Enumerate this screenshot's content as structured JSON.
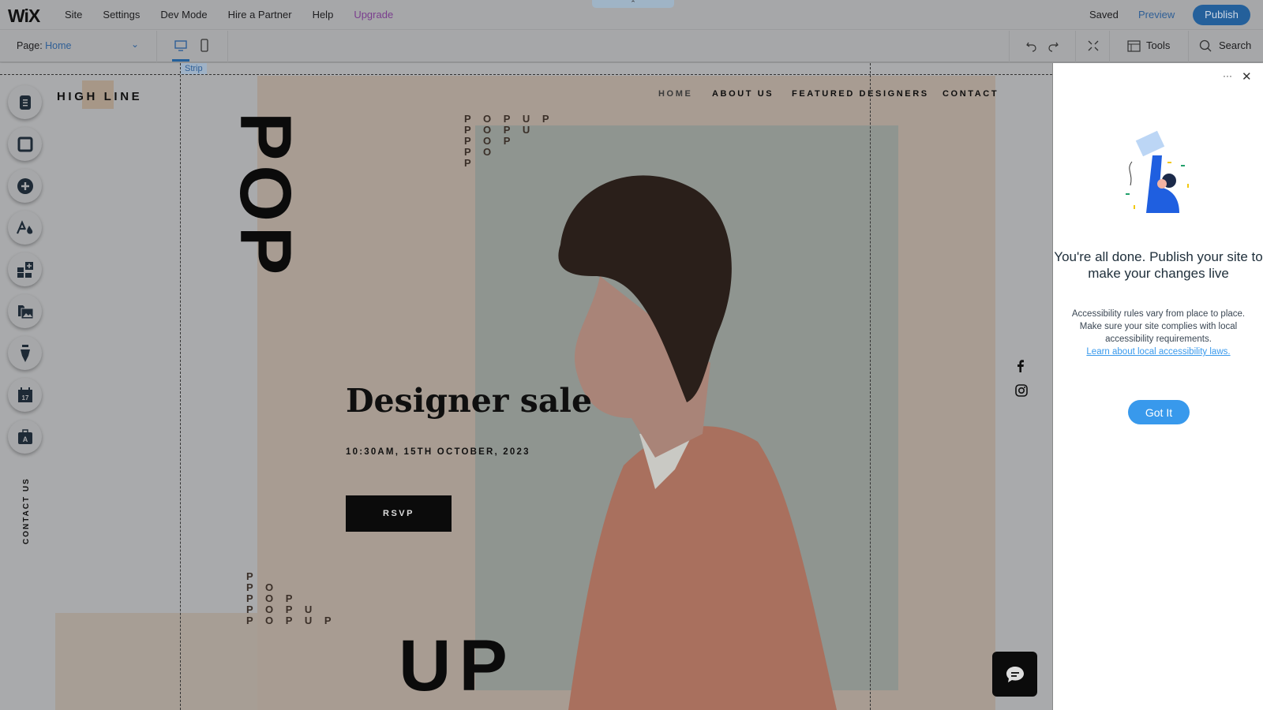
{
  "topbar": {
    "logo": "WiX",
    "menu": [
      "Site",
      "Settings",
      "Dev Mode",
      "Hire a Partner",
      "Help",
      "Upgrade"
    ],
    "saved": "Saved",
    "preview": "Preview",
    "publish": "Publish"
  },
  "toolbar": {
    "page_label": "Page:",
    "page_value": "Home",
    "tools": "Tools",
    "search": "Search",
    "active_view": "desktop"
  },
  "canvas": {
    "strip_label": "Strip",
    "left_tools": [
      "pages-icon",
      "section-icon",
      "add-icon",
      "theme-icon",
      "apps-icon",
      "media-icon",
      "blog-icon",
      "bookings-icon",
      "portfolio-icon"
    ]
  },
  "site": {
    "brand": "HIGH LINE",
    "nav": [
      "HOME",
      "ABOUT US",
      "FEATURED DESIGNERS",
      "CONTACT"
    ],
    "pop_vertical": "POP",
    "pop_stack_top": "P O P U P\nP O P U\nP O P\nP O\nP",
    "pop_stack_bottom": "P\nP O\nP O P\nP O P U\nP O P U P",
    "headline": "Designer sale",
    "date": "10:30AM, 15TH OCTOBER, 2023",
    "rsvp": "RSVP",
    "up": "UP",
    "side_text": "CONTACT US",
    "social": [
      "facebook-icon",
      "instagram-icon"
    ]
  },
  "panel": {
    "title": "You're all done. Publish your site to make your changes live",
    "body": "Accessibility rules vary from place to place. Make sure your site complies with local accessibility requirements.",
    "link": "Learn about local accessibility laws.",
    "button": "Got It"
  },
  "colors": {
    "accent": "#3899ec",
    "publish": "#24609b",
    "upgrade": "#7a3e8e"
  }
}
